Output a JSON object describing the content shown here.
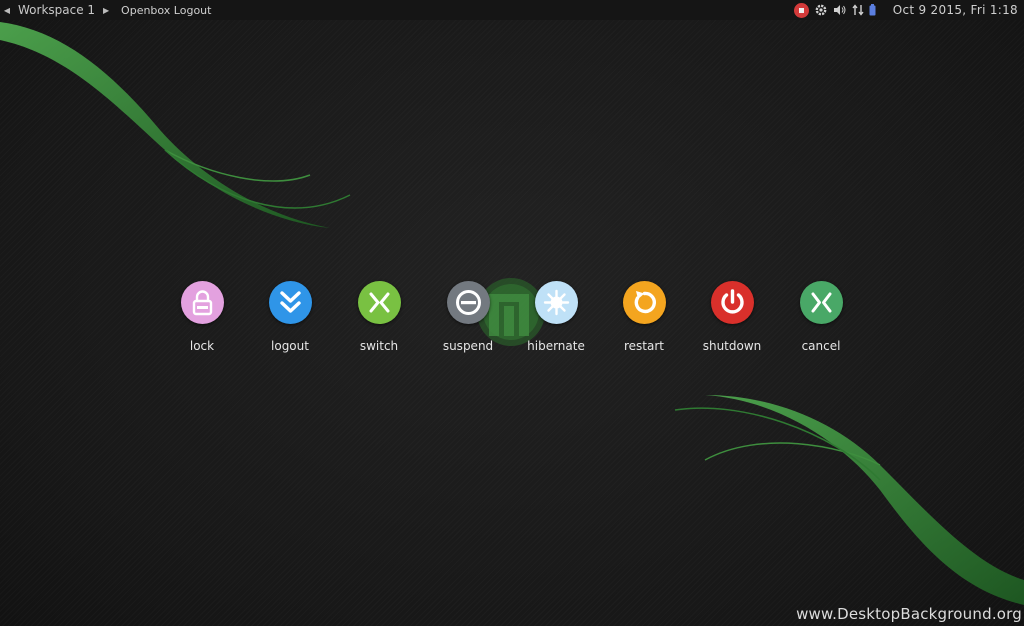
{
  "panel": {
    "workspace": "Workspace 1",
    "window_title": "Openbox Logout",
    "clock": "Oct  9 2015, Fri  1:18",
    "tray_icons": [
      "record-icon",
      "gear-icon",
      "volume-icon",
      "network-icon",
      "battery-icon"
    ]
  },
  "actions": [
    {
      "id": "lock",
      "label": "lock",
      "color": "#e3a1df",
      "icon": "lock-icon"
    },
    {
      "id": "logout",
      "label": "logout",
      "color": "#2f95e8",
      "icon": "double-chevron-down-icon"
    },
    {
      "id": "switch",
      "label": "switch",
      "color": "#79c142",
      "icon": "switch-icon"
    },
    {
      "id": "suspend",
      "label": "suspend",
      "color": "#737980",
      "icon": "suspend-icon"
    },
    {
      "id": "hibernate",
      "label": "hibernate",
      "color": "#bfe1f7",
      "icon": "snowflake-icon"
    },
    {
      "id": "restart",
      "label": "restart",
      "color": "#f4a51f",
      "icon": "restart-icon"
    },
    {
      "id": "shutdown",
      "label": "shutdown",
      "color": "#d9302b",
      "icon": "power-icon"
    },
    {
      "id": "cancel",
      "label": "cancel",
      "color": "#49a867",
      "icon": "close-icon"
    }
  ],
  "colors": {
    "background": "#1a1a1a",
    "panel": "#151515",
    "swoosh": "#3a8a3a"
  },
  "watermark": "www.DesktopBackground.org"
}
